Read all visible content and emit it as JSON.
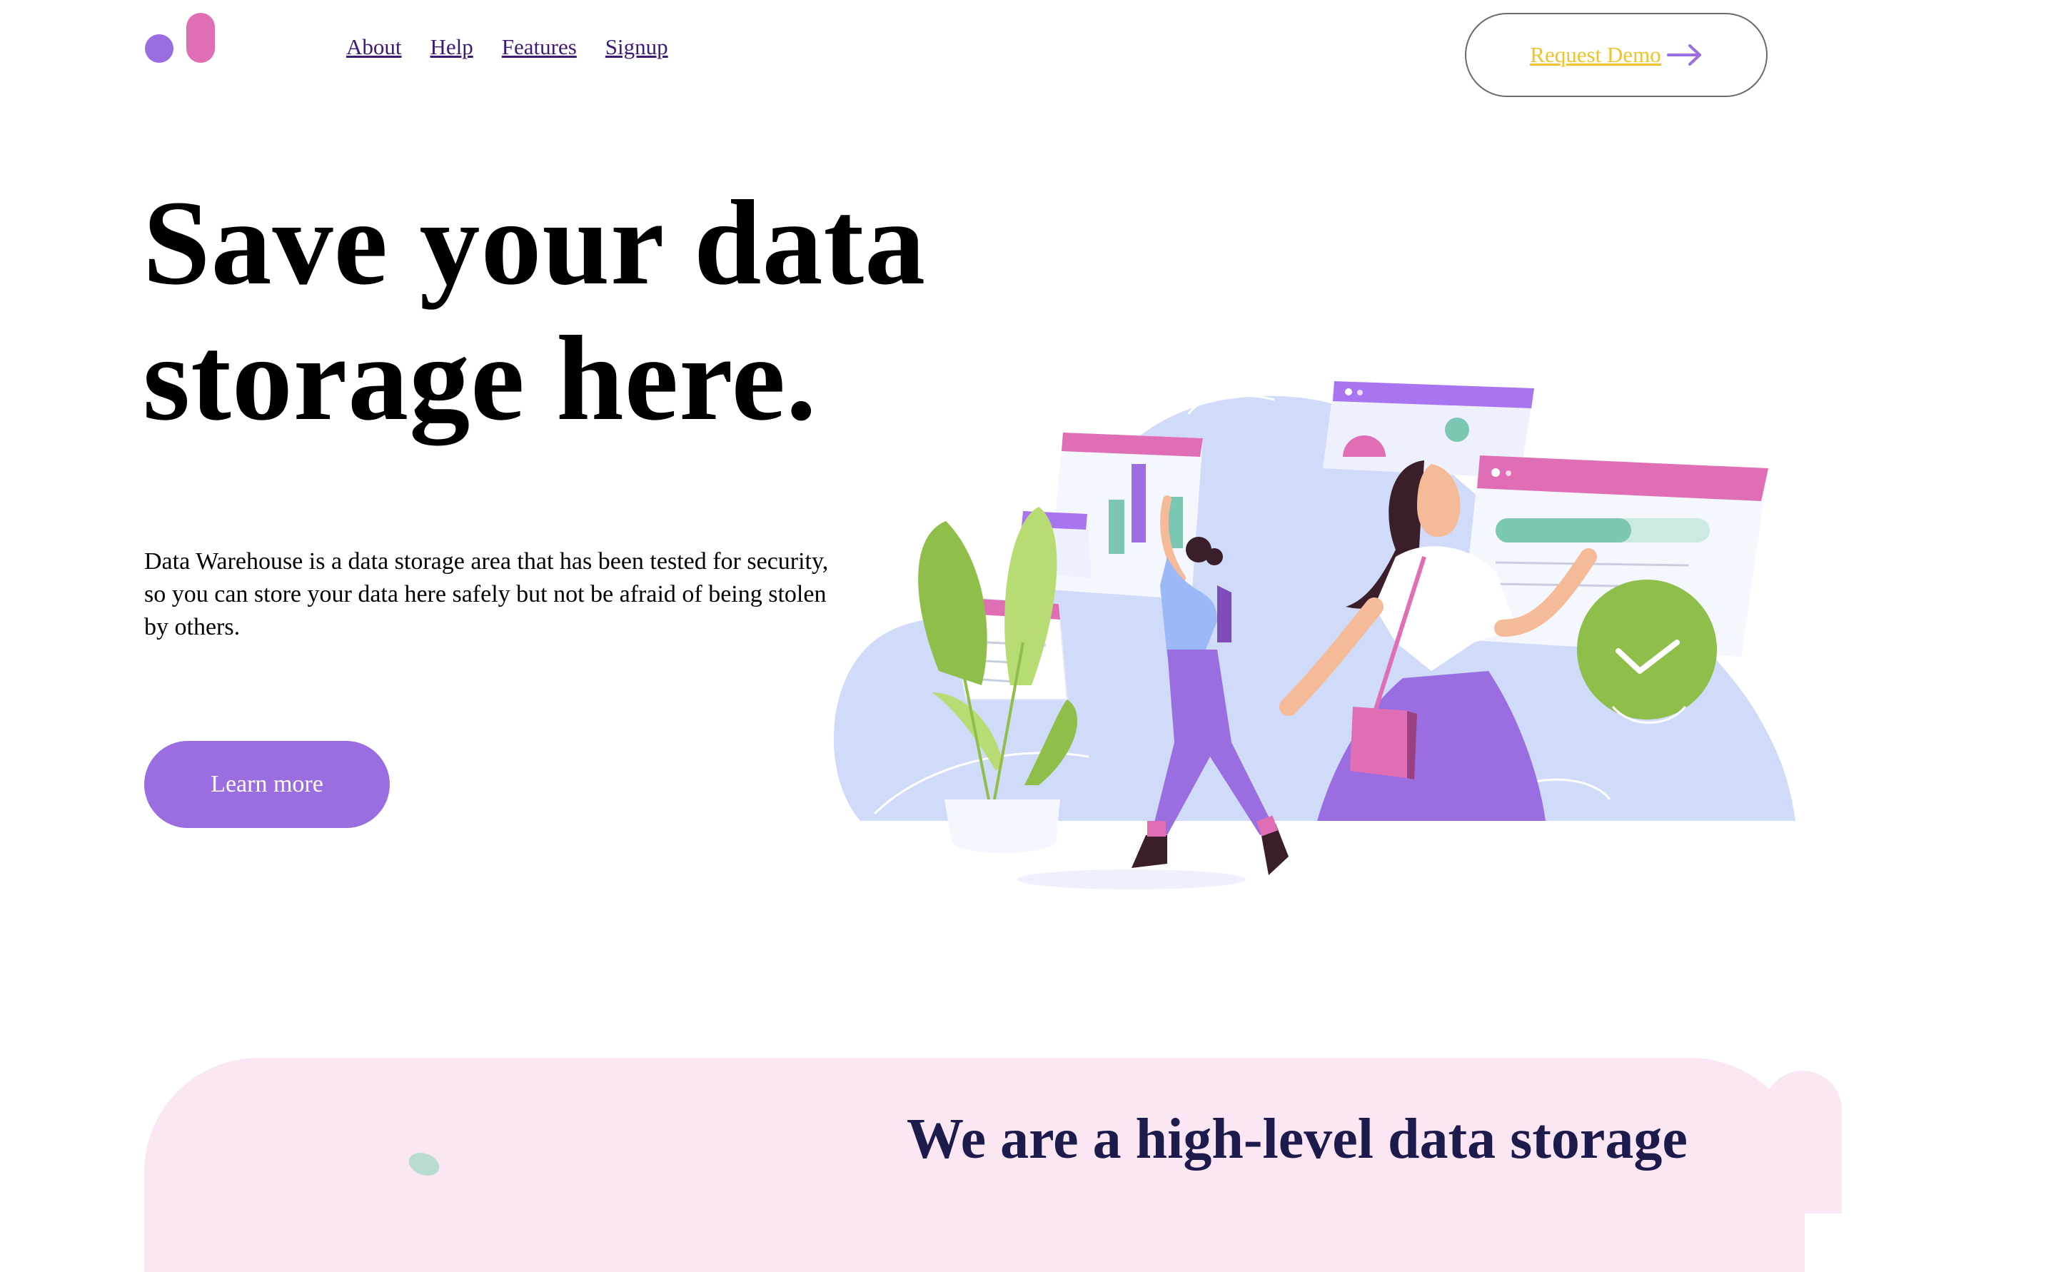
{
  "colors": {
    "brand_purple": "#9a6ee0",
    "brand_pink": "#e06eb5",
    "nav_link": "#3d1a78",
    "demo_text": "#f0c22c",
    "section_bg": "#fae7f3",
    "section_title": "#1d1b4b",
    "check_green": "#8fbe4a"
  },
  "nav": {
    "links": [
      {
        "label": "About"
      },
      {
        "label": "Help"
      },
      {
        "label": "Features"
      },
      {
        "label": "Signup"
      }
    ],
    "demo_button": {
      "label": "Request Demo",
      "icon": "arrow-right-icon"
    }
  },
  "hero": {
    "title": "Save your data storage here.",
    "description": "Data Warehouse is a data storage area that has been tested for security, so you can store your data here safely but not be afraid of being stolen by others.",
    "cta_label": "Learn more"
  },
  "section2": {
    "title": "We are a high-level data storage"
  }
}
